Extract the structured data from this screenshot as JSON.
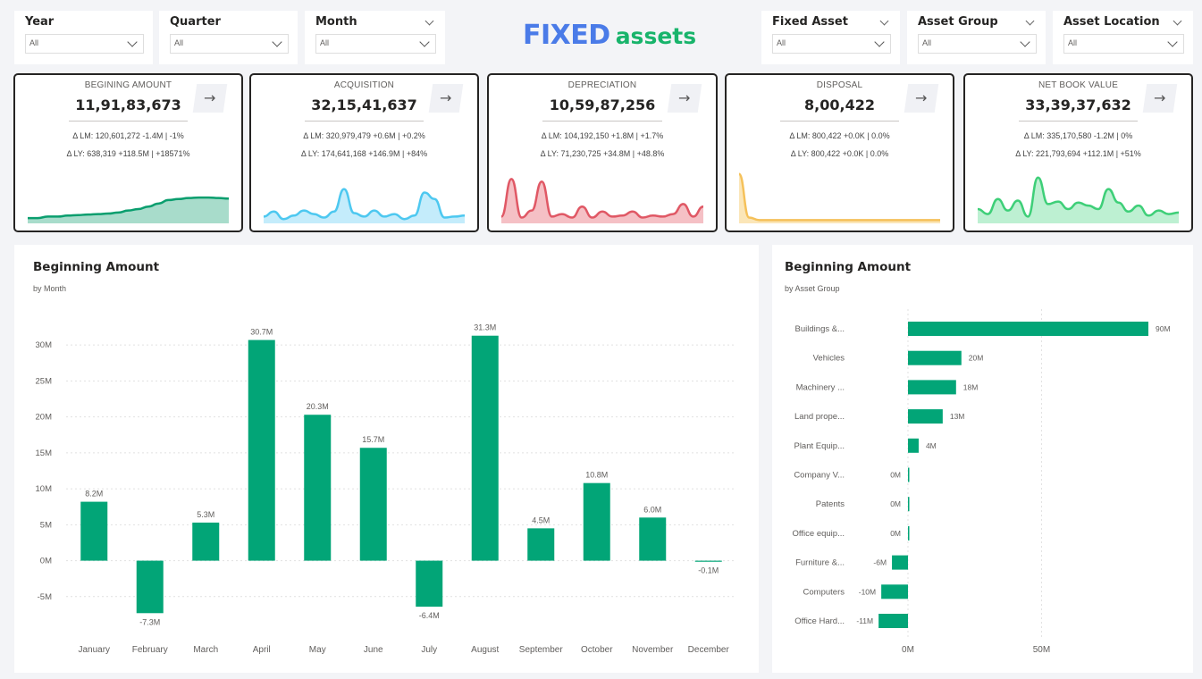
{
  "filters_left": [
    {
      "label": "Year",
      "value": "All"
    },
    {
      "label": "Quarter",
      "value": "All"
    },
    {
      "label": "Month",
      "value": "All"
    }
  ],
  "filters_right": [
    {
      "label": "Fixed Asset",
      "value": "All"
    },
    {
      "label": "Asset Group",
      "value": "All"
    },
    {
      "label": "Asset Location",
      "value": "All"
    }
  ],
  "logo": {
    "part1": "FIXED",
    "part2": "assets"
  },
  "kpis": [
    {
      "title": "BEGINING AMOUNT",
      "value": "11,91,83,673",
      "lm": "Δ LM:  120,601,272  -1.4M | -1%",
      "ly": "Δ LY:  638,319  +118.5M | +18571%",
      "color": "#0a9e6e",
      "fill": "#a8dccb",
      "trend": [
        0.93,
        0.93,
        0.9,
        0.9,
        0.88,
        0.87,
        0.86,
        0.85,
        0.84,
        0.82,
        0.78,
        0.75,
        0.7,
        0.64,
        0.57,
        0.55,
        0.53,
        0.52,
        0.52,
        0.53,
        0.54
      ]
    },
    {
      "title": "ACQUISITION",
      "value": "32,15,41,637",
      "lm": "Δ LM:  320,979,479  +0.6M | +0.2%",
      "ly": "Δ LY:  174,641,168  +146.9M | +84%",
      "color": "#4dc8f0",
      "fill": "#c4ecfb",
      "trend": [
        0.9,
        0.8,
        0.95,
        0.88,
        0.78,
        0.85,
        0.92,
        0.8,
        0.35,
        0.83,
        0.9,
        0.78,
        0.9,
        0.85,
        0.95,
        0.88,
        0.42,
        0.55,
        0.92,
        0.9,
        0.88
      ]
    },
    {
      "title": "DEPRECIATION",
      "value": "10,59,87,256",
      "lm": "Δ LM:  104,192,150  +1.8M | +1.7%",
      "ly": "Δ LY:  71,230,725  +34.8M | +48.8%",
      "color": "#e05865",
      "fill": "#f5c0c5",
      "trend": [
        0.9,
        0.15,
        0.92,
        0.78,
        0.2,
        0.9,
        0.85,
        0.92,
        0.7,
        0.92,
        0.8,
        0.9,
        0.88,
        0.8,
        0.92,
        0.88,
        0.9,
        0.85,
        0.65,
        0.9,
        0.7
      ]
    },
    {
      "title": "DISPOSAL",
      "value": "8,00,422",
      "lm": "Δ LM:  800,422  +0.0K | 0.0%",
      "ly": "Δ LY:  800,422  +0.0K | 0.0%",
      "color": "#f5c15a",
      "fill": "#fbe6b8",
      "trend": [
        0.05,
        0.92,
        0.97,
        0.97,
        0.97,
        0.97,
        0.97,
        0.97,
        0.97,
        0.97,
        0.97,
        0.97,
        0.97,
        0.97,
        0.97,
        0.97,
        0.97,
        0.97,
        0.97,
        0.97,
        0.97
      ]
    },
    {
      "title": "NET BOOK VALUE",
      "value": "33,39,37,632",
      "lm": "Δ LM:  335,170,580  -1.2M | 0%",
      "ly": "Δ LY:  221,793,694  +112.1M | +51%",
      "color": "#3ecf78",
      "fill": "#bdf0d2",
      "trend": [
        0.75,
        0.85,
        0.55,
        0.78,
        0.58,
        0.9,
        0.12,
        0.65,
        0.6,
        0.75,
        0.62,
        0.68,
        0.75,
        0.35,
        0.62,
        0.8,
        0.68,
        0.88,
        0.78,
        0.85,
        0.82
      ]
    }
  ],
  "month_panel": {
    "title": "Beginning Amount",
    "subtitle": "by Month"
  },
  "group_panel": {
    "title": "Beginning Amount",
    "subtitle": "by Asset Group"
  },
  "chart_data": [
    {
      "type": "bar",
      "title": "Beginning Amount",
      "subtitle": "by Month",
      "categories": [
        "January",
        "February",
        "March",
        "April",
        "May",
        "June",
        "July",
        "August",
        "September",
        "October",
        "November",
        "December"
      ],
      "values": [
        8.2,
        -7.3,
        5.3,
        30.7,
        20.3,
        15.7,
        -6.4,
        31.3,
        4.5,
        10.8,
        6.0,
        -0.1
      ],
      "data_labels": [
        "8.2M",
        "-7.3M",
        "5.3M",
        "30.7M",
        "20.3M",
        "15.7M",
        "-6.4M",
        "31.3M",
        "4.5M",
        "10.8M",
        "6.0M",
        "-0.1M"
      ],
      "y_ticks": [
        -5,
        0,
        5,
        10,
        15,
        20,
        25,
        30
      ],
      "y_tick_labels": [
        "-5M",
        "0M",
        "5M",
        "10M",
        "15M",
        "20M",
        "25M",
        "30M"
      ],
      "ylim": [
        -9.5,
        34
      ],
      "grid": true,
      "color": "#02a577"
    },
    {
      "type": "bar",
      "orientation": "horizontal",
      "title": "Beginning Amount",
      "subtitle": "by Asset Group",
      "categories": [
        "Buildings &...",
        "Vehicles",
        "Machinery ...",
        "Land prope...",
        "Plant Equip...",
        "Company V...",
        "Patents",
        "Office equip...",
        "Furniture &...",
        "Computers",
        "Office Hard..."
      ],
      "values": [
        90,
        20,
        18,
        13,
        4,
        0.1,
        0.1,
        0.1,
        -6,
        -10,
        -11
      ],
      "data_labels": [
        "90M",
        "20M",
        "18M",
        "13M",
        "4M",
        "0M",
        "0M",
        "0M",
        "-6M",
        "-10M",
        "-11M"
      ],
      "x_ticks": [
        0,
        50
      ],
      "x_tick_labels": [
        "0M",
        "50M"
      ],
      "xlim": [
        -11,
        90
      ],
      "grid": true,
      "color": "#02a577"
    }
  ]
}
